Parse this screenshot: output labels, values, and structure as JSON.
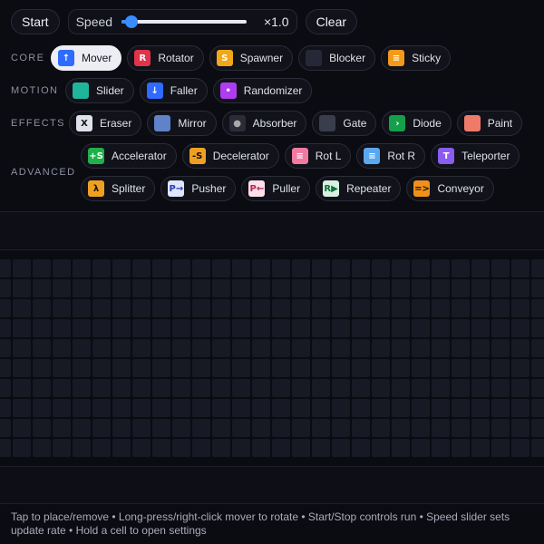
{
  "toolbar": {
    "start_label": "Start",
    "speed_label": "Speed",
    "speed_value": "×1.0",
    "speed_fraction": 0.08,
    "clear_label": "Clear"
  },
  "categories": [
    {
      "name": "CORE",
      "rows": [
        [
          {
            "label": "Mover",
            "icon": "mover-icon",
            "glyph": "↑",
            "bg": "#2f6bff",
            "selected": true
          },
          {
            "label": "Rotator",
            "icon": "rotator-icon",
            "glyph": "R",
            "bg": "#e0344a"
          },
          {
            "label": "Spawner",
            "icon": "spawner-icon",
            "glyph": "S",
            "bg": "#f0a81a"
          },
          {
            "label": "Blocker",
            "icon": "blocker-icon",
            "glyph": "",
            "bg": "#262838"
          },
          {
            "label": "Sticky",
            "icon": "sticky-icon",
            "glyph": "≡",
            "bg": "#f39a1a"
          }
        ]
      ]
    },
    {
      "name": "MOTION",
      "rows": [
        [
          {
            "label": "Slider",
            "icon": "slider-icon",
            "glyph": "",
            "bg": "#1fb59a"
          },
          {
            "label": "Faller",
            "icon": "faller-icon",
            "glyph": "↓",
            "bg": "#2f6bff"
          },
          {
            "label": "Randomizer",
            "icon": "randomizer-icon",
            "glyph": "•",
            "bg": "#b03cf0"
          }
        ]
      ]
    },
    {
      "name": "EFFECTS",
      "rows": [
        [
          {
            "label": "Eraser",
            "icon": "eraser-icon",
            "glyph": "X",
            "bg": "#dfe2ea",
            "color": "#111"
          },
          {
            "label": "Mirror",
            "icon": "mirror-icon",
            "glyph": "",
            "bg": "#5f82c8"
          },
          {
            "label": "Absorber",
            "icon": "absorber-icon",
            "glyph": "●",
            "bg": "#2a2c38",
            "color": "#aaa"
          },
          {
            "label": "Gate",
            "icon": "gate-icon",
            "glyph": "",
            "bg": "#3a3d4c"
          },
          {
            "label": "Diode",
            "icon": "diode-icon",
            "glyph": "›",
            "bg": "#14a04a"
          },
          {
            "label": "Paint",
            "icon": "paint-icon",
            "glyph": "",
            "bg": "#f07a6a"
          }
        ]
      ]
    },
    {
      "name": "ADVANCED",
      "rows": [
        [
          {
            "label": "Accelerator",
            "icon": "accelerator-icon",
            "glyph": "+S",
            "bg": "#1fb04a"
          },
          {
            "label": "Decelerator",
            "icon": "decelerator-icon",
            "glyph": "-S",
            "bg": "#f0a020",
            "color": "#111"
          },
          {
            "label": "Rot L",
            "icon": "rot-left-icon",
            "glyph": "≡",
            "bg": "#f07aa0"
          },
          {
            "label": "Rot R",
            "icon": "rot-right-icon",
            "glyph": "≡",
            "bg": "#5aa8f0"
          },
          {
            "label": "Teleporter",
            "icon": "teleporter-icon",
            "glyph": "T",
            "bg": "#8a5cf0"
          }
        ],
        [
          {
            "label": "Splitter",
            "icon": "splitter-icon",
            "glyph": "λ",
            "bg": "#f0a020",
            "color": "#111"
          },
          {
            "label": "Pusher",
            "icon": "pusher-icon",
            "glyph": "P→",
            "bg": "#dfe6ff",
            "color": "#2a3cb0"
          },
          {
            "label": "Puller",
            "icon": "puller-icon",
            "glyph": "P←",
            "bg": "#ffe0ea",
            "color": "#b02a50"
          },
          {
            "label": "Repeater",
            "icon": "repeater-icon",
            "glyph": "R▶",
            "bg": "#d8f0e0",
            "color": "#10703a"
          },
          {
            "label": "Conveyor",
            "icon": "conveyor-icon",
            "glyph": "=>",
            "bg": "#f0901a",
            "color": "#111"
          }
        ]
      ]
    }
  ],
  "help_text": "Tap to place/remove • Long-press/right-click mover to rotate • Start/Stop controls run • Speed slider sets update rate • Hold a cell to open settings"
}
